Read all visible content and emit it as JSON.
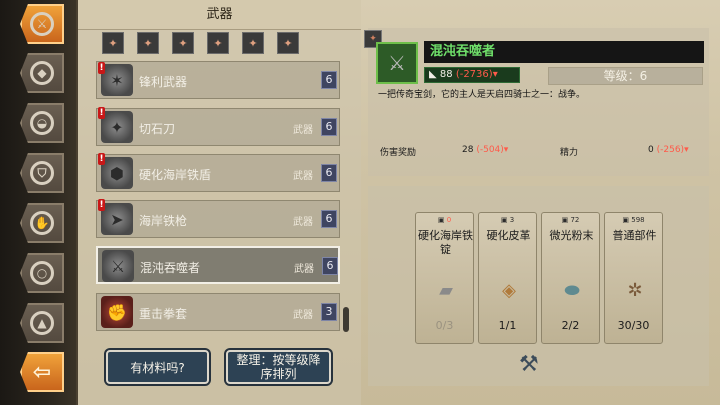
{
  "header": {
    "title": "武器"
  },
  "heroes": [
    "✦",
    "✦",
    "✦",
    "✦",
    "✦",
    "✦"
  ],
  "items": [
    {
      "name": "锋利武器",
      "type": "",
      "level": "6",
      "warn": true,
      "selected": false
    },
    {
      "name": "切石刀",
      "type": "武器",
      "level": "6",
      "warn": true,
      "selected": false
    },
    {
      "name": "硬化海岸铁盾",
      "type": "武器",
      "level": "6",
      "warn": true,
      "selected": false
    },
    {
      "name": "海岸铁枪",
      "type": "武器",
      "level": "6",
      "warn": true,
      "selected": false
    },
    {
      "name": "混沌吞噬者",
      "type": "武器",
      "level": "6",
      "warn": false,
      "selected": true
    },
    {
      "name": "重击拳套",
      "type": "武器",
      "level": "3",
      "warn": false,
      "selected": false
    }
  ],
  "buttons": {
    "has_material": "有材料吗?",
    "sort": "整理：按等级降序排列"
  },
  "detail": {
    "name": "混沌吞噬者",
    "power": "88",
    "power_delta": "(-2736)",
    "level_label": "等级：6",
    "description": "一把传奇宝剑，它的主人是天启四骑士之一：战争。",
    "stats": [
      {
        "label": "伤害奖励",
        "value": "28",
        "delta": "(-504)"
      },
      {
        "label": "精力",
        "value": "0",
        "delta": "(-256)"
      }
    ]
  },
  "materials": [
    {
      "count": "0",
      "name": "硬化海岸铁锭",
      "progress": "0/3",
      "icon": "ingot-icon"
    },
    {
      "count": "3",
      "name": "硬化皮革",
      "progress": "1/1",
      "icon": "leather-icon"
    },
    {
      "count": "72",
      "name": "微光粉末",
      "progress": "2/2",
      "icon": "dust-icon"
    },
    {
      "count": "598",
      "name": "普通部件",
      "progress": "30/30",
      "icon": "parts-icon"
    }
  ],
  "nav": [
    "weapons",
    "armor",
    "helmet",
    "shield",
    "glove",
    "ring",
    "boots",
    "back"
  ],
  "colors": {
    "rarity_green": "#6fe06a",
    "warning_red": "#c81717",
    "accent_orange": "#f0a23a"
  }
}
